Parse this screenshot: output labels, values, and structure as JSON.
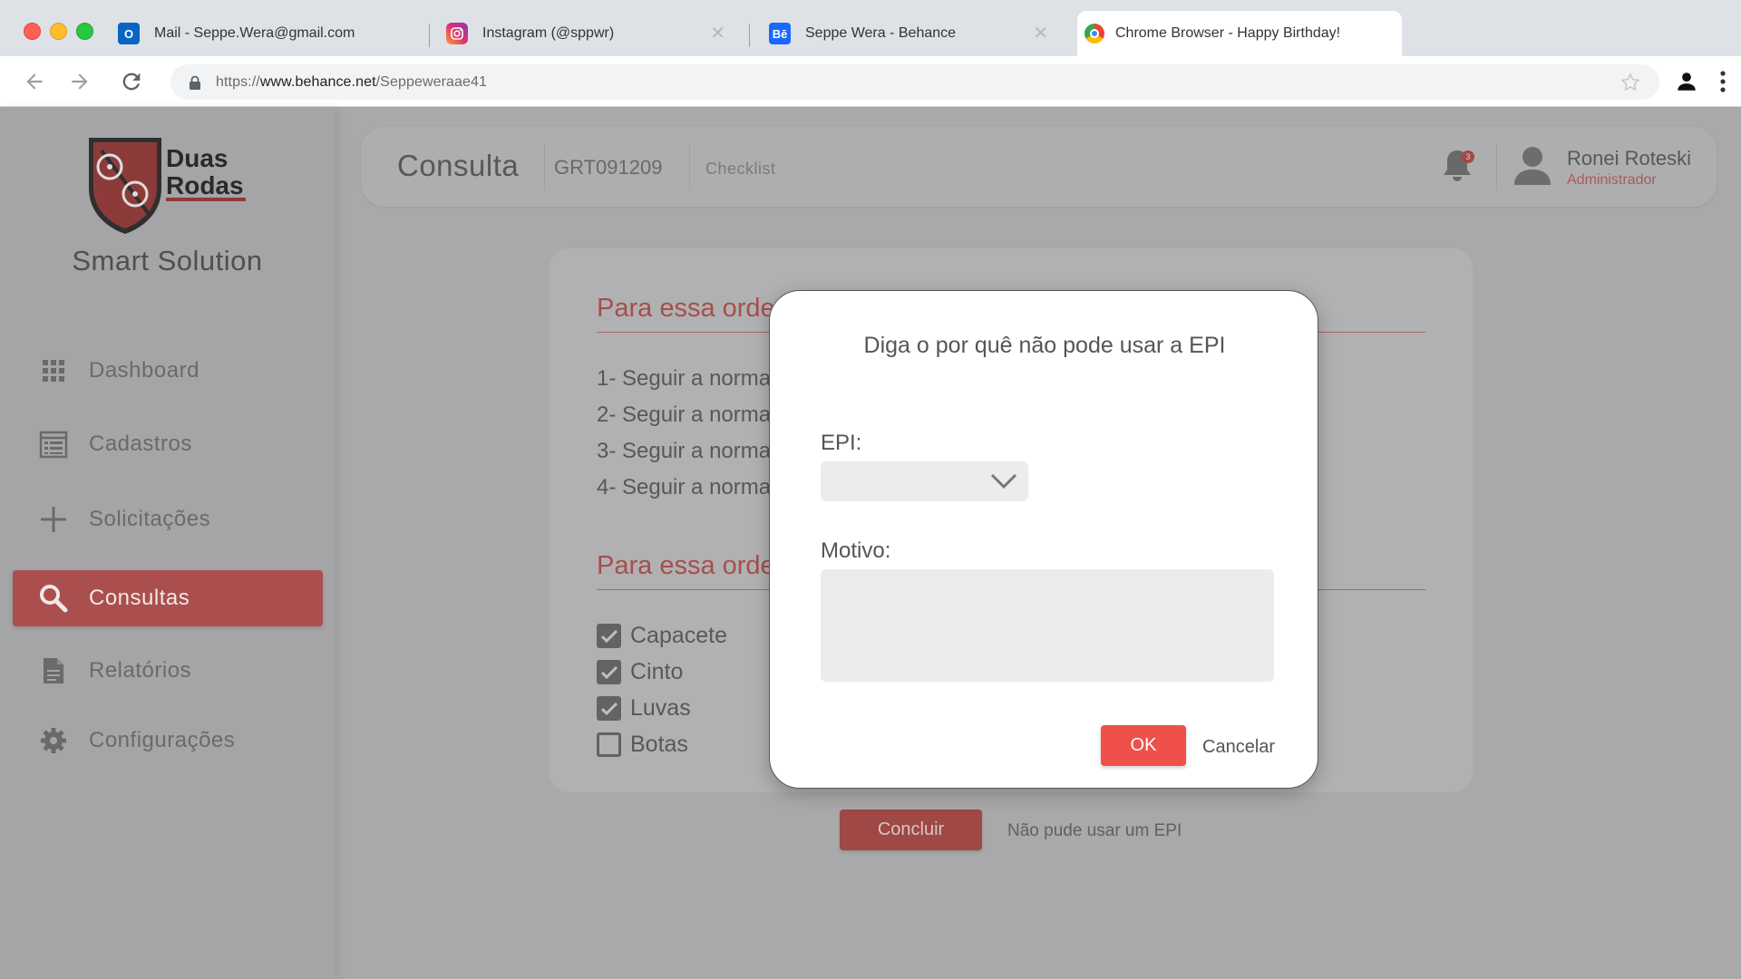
{
  "browser": {
    "tabs": [
      {
        "label": "Mail - Seppe.Wera@gmail.com",
        "icon": "outlook-icon"
      },
      {
        "label": "Instagram (@sppwr)",
        "icon": "instagram-icon"
      },
      {
        "label": "Seppe Wera - Behance",
        "icon": "behance-icon"
      },
      {
        "label": "Chrome Browser - Happy Birthday!",
        "icon": "chrome-icon"
      }
    ],
    "url_prefix": "https://",
    "url_domain": "www.behance.net",
    "url_path": "/Seppeweraae41"
  },
  "sidebar": {
    "logo_line1": "Duas",
    "logo_line2": "Rodas",
    "brand": "Smart Solution",
    "items": [
      {
        "label": "Dashboard",
        "icon": "grid-icon"
      },
      {
        "label": "Cadastros",
        "icon": "form-icon"
      },
      {
        "label": "Solicitações",
        "icon": "plus-icon"
      },
      {
        "label": "Consultas",
        "icon": "search-icon"
      },
      {
        "label": "Relatórios",
        "icon": "document-icon"
      },
      {
        "label": "Configurações",
        "icon": "gear-icon"
      }
    ]
  },
  "header": {
    "title": "Consulta",
    "code": "GRT091209",
    "checklist": "Checklist",
    "notification_count": "3",
    "user_name": "Ronei Roteski",
    "user_role": "Administrador"
  },
  "card": {
    "section1_title": "Para essa orde",
    "rules": [
      "1- Seguir a norma",
      "2- Seguir a norma",
      "3- Seguir a norma",
      "4- Seguir a norma"
    ],
    "section2_title": "Para essa orde",
    "epis": [
      {
        "label": "Capacete",
        "checked": true
      },
      {
        "label": "Cinto",
        "checked": true
      },
      {
        "label": "Luvas",
        "checked": true
      },
      {
        "label": "Botas",
        "checked": false
      }
    ]
  },
  "actions": {
    "concluir": "Concluir",
    "nao_pude": "Não pude usar um EPI"
  },
  "modal": {
    "title": "Diga o por quê não pode usar a EPI",
    "epi_label": "EPI:",
    "epi_value": "",
    "motivo_label": "Motivo:",
    "motivo_value": "",
    "ok": "OK",
    "cancel": "Cancelar"
  },
  "colors": {
    "accent": "#f0504a",
    "sidebar_active": "#aa4f4d",
    "overlay": "#a9a9ab"
  }
}
